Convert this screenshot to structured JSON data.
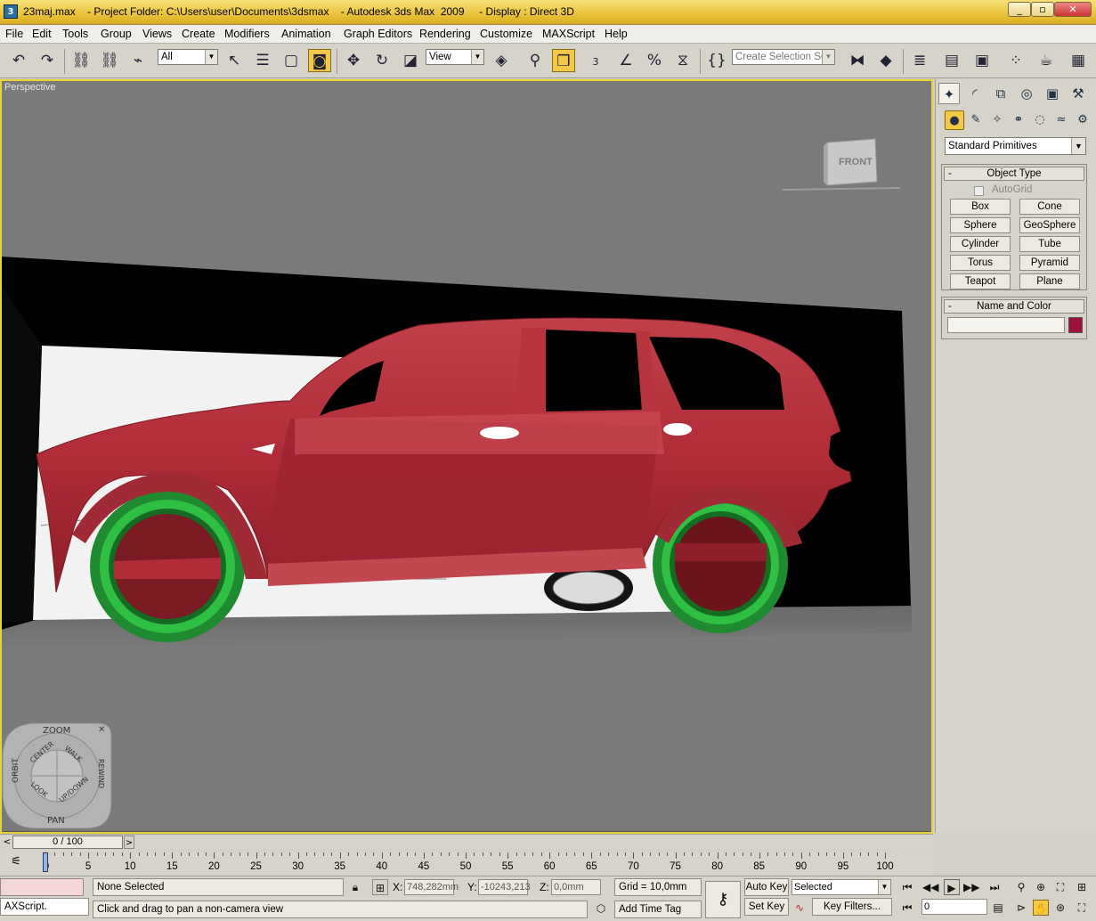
{
  "window": {
    "title": "23maj.max    - Project Folder: C:\\Users\\user\\Documents\\3dsmax    - Autodesk 3ds Max  2009     - Display : Direct 3D",
    "minimize_label": "_",
    "maximize_label": "▫",
    "close_label": "✕"
  },
  "menu": [
    "File",
    "Edit",
    "Tools",
    "Group",
    "Views",
    "Create",
    "Modifiers",
    "Animation",
    "Graph Editors",
    "Rendering",
    "Customize",
    "MAXScript",
    "Help"
  ],
  "toolbar": {
    "selection_filter": "All",
    "reference_coord": "View",
    "named_selection_placeholder": "Create Selection Set",
    "angle_snap_label": "3"
  },
  "viewport": {
    "label": "Perspective",
    "viewcube_label": "FRONT",
    "steering_wheel": {
      "zoom": "ZOOM",
      "orbit": "ORBIT",
      "center": "CENTER",
      "walk": "WALK",
      "rewind": "REWIND",
      "look": "LOOK",
      "updown": "UP/DOWN",
      "pan": "PAN"
    },
    "colors": {
      "background": "#7a7a7a",
      "car_body": "#b8343f",
      "wheels": "#27b03a",
      "backdrop": "#000000"
    }
  },
  "command_panel": {
    "category_dropdown": "Standard Primitives",
    "object_type": {
      "title": "Object Type",
      "autogrid": "AutoGrid",
      "buttons": [
        "Box",
        "Cone",
        "Sphere",
        "GeoSphere",
        "Cylinder",
        "Tube",
        "Torus",
        "Pyramid",
        "Teapot",
        "Plane"
      ]
    },
    "name_and_color": {
      "title": "Name and Color",
      "name_value": "",
      "color": "#a0103a"
    },
    "collapse_symbol": "-"
  },
  "time_slider": {
    "position": "0 / 100",
    "prev": "<",
    "next": ">"
  },
  "trackbar": {
    "ticks": [
      "0",
      "5",
      "10",
      "15",
      "20",
      "25",
      "30",
      "35",
      "40",
      "45",
      "50",
      "55",
      "60",
      "65",
      "70",
      "75",
      "80",
      "85",
      "90",
      "95",
      "100"
    ]
  },
  "status": {
    "maxscript_listener": "AXScript.",
    "selection": "None Selected",
    "prompt": "Click and drag to pan a non-camera view",
    "x_label": "X:",
    "x_value": "748,282mm",
    "y_label": "Y:",
    "y_value": "-10243,213",
    "z_label": "Z:",
    "z_value": "0,0mm",
    "grid": "Grid = 10,0mm",
    "add_time_tag": "Add Time Tag",
    "auto_key": "Auto Key",
    "set_key": "Set Key",
    "key_mode_dropdown": "Selected",
    "key_filters": "Key Filters...",
    "current_frame": "0"
  }
}
